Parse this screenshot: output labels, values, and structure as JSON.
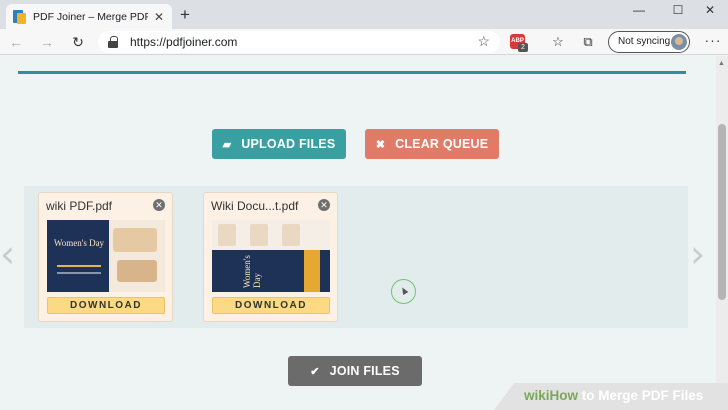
{
  "browser": {
    "tab": {
      "title": "PDF Joiner – Merge PDF Files Or",
      "close": "✕"
    },
    "new_tab": "+",
    "window_controls": {
      "minimize": "—",
      "maximize": "☐",
      "close": "✕"
    },
    "nav": {
      "back": "←",
      "forward": "→",
      "reload": "↻"
    },
    "address": {
      "url": "https://pdfjoiner.com",
      "star": "☆"
    },
    "extensions": {
      "abp_label": "ABP",
      "abp_count": "2"
    },
    "sync": {
      "label": "Not syncing"
    },
    "menu": "···"
  },
  "page": {
    "upload_button": {
      "label": "UPLOAD FILES",
      "icon": "📂"
    },
    "clear_button": {
      "label": "CLEAR QUEUE",
      "icon": "✖"
    },
    "join_button": {
      "label": "JOIN FILES",
      "icon": "✔"
    },
    "nav_arrows": {
      "left": "‹",
      "right": "›"
    },
    "files": [
      {
        "name": "wiki PDF.pdf",
        "download_label": "DOWNLOAD",
        "thumb_text": "Women's Day"
      },
      {
        "name": "Wiki Docu...t.pdf",
        "download_label": "DOWNLOAD",
        "thumb_text": "Women's Day"
      }
    ]
  },
  "watermark": {
    "wiki": "wiki",
    "how": "How",
    "rest": " to Merge PDF Files"
  },
  "colors": {
    "teal": "#3a9fa1",
    "coral": "#e07b68",
    "gray": "#6b6b6b",
    "download": "#fbd985"
  }
}
